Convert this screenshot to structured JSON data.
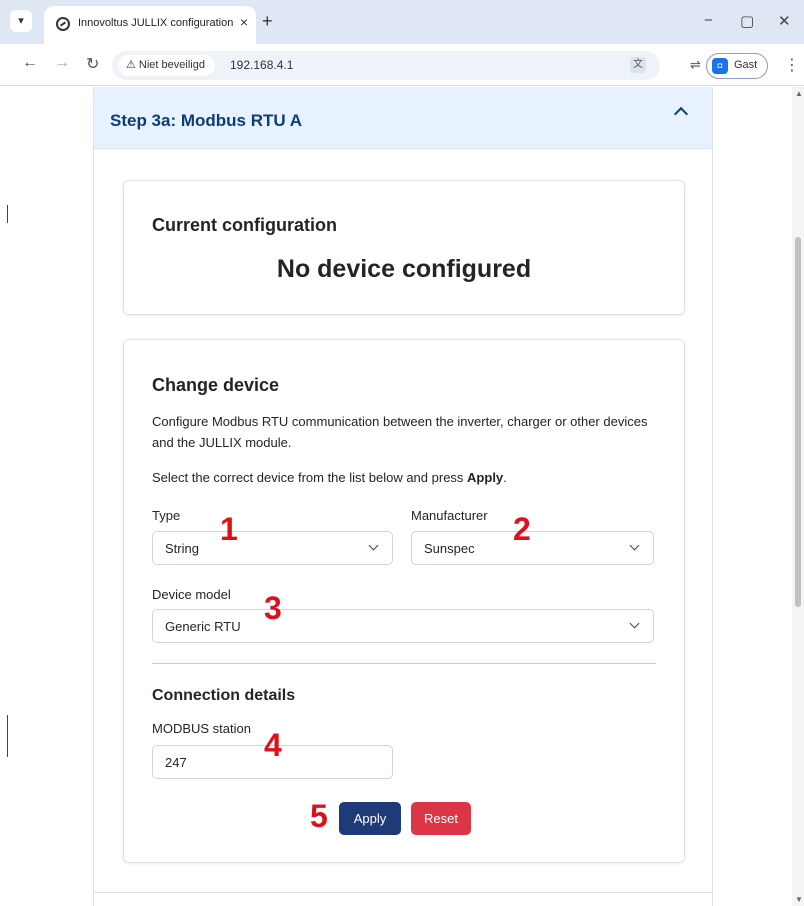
{
  "browser": {
    "tab_title": "Innovoltus JULLIX configuration",
    "tab_close": "×",
    "new_tab": "+",
    "security_label": "Niet beveiligd",
    "url": "192.168.4.1",
    "profile_label": "Gast",
    "window_controls": {
      "minimize": "−",
      "maximize": "▢",
      "close": "✕"
    }
  },
  "accordion": {
    "title": "Step 3a: Modbus RTU A"
  },
  "current_config": {
    "heading": "Current configuration",
    "status": "No device configured"
  },
  "change_device": {
    "heading": "Change device",
    "description": "Configure Modbus RTU communication between the inverter, charger or other devices and the JULLIX module.",
    "instruction_prefix": "Select the correct device from the list below and press ",
    "instruction_bold": "Apply",
    "instruction_suffix": ".",
    "type_label": "Type",
    "type_value": "String",
    "manufacturer_label": "Manufacturer",
    "manufacturer_value": "Sunspec",
    "model_label": "Device model",
    "model_value": "Generic RTU"
  },
  "connection": {
    "heading": "Connection details",
    "station_label": "MODBUS station",
    "station_value": "247"
  },
  "buttons": {
    "apply": "Apply",
    "reset": "Reset"
  },
  "annotations": [
    "1",
    "2",
    "3",
    "4",
    "5"
  ],
  "colors": {
    "accordion_header_bg": "#e7f1ff",
    "accordion_title": "#0c3d7a",
    "apply_button": "#1e3a78",
    "reset_button": "#dc3545",
    "annotation": "#e0101a"
  }
}
